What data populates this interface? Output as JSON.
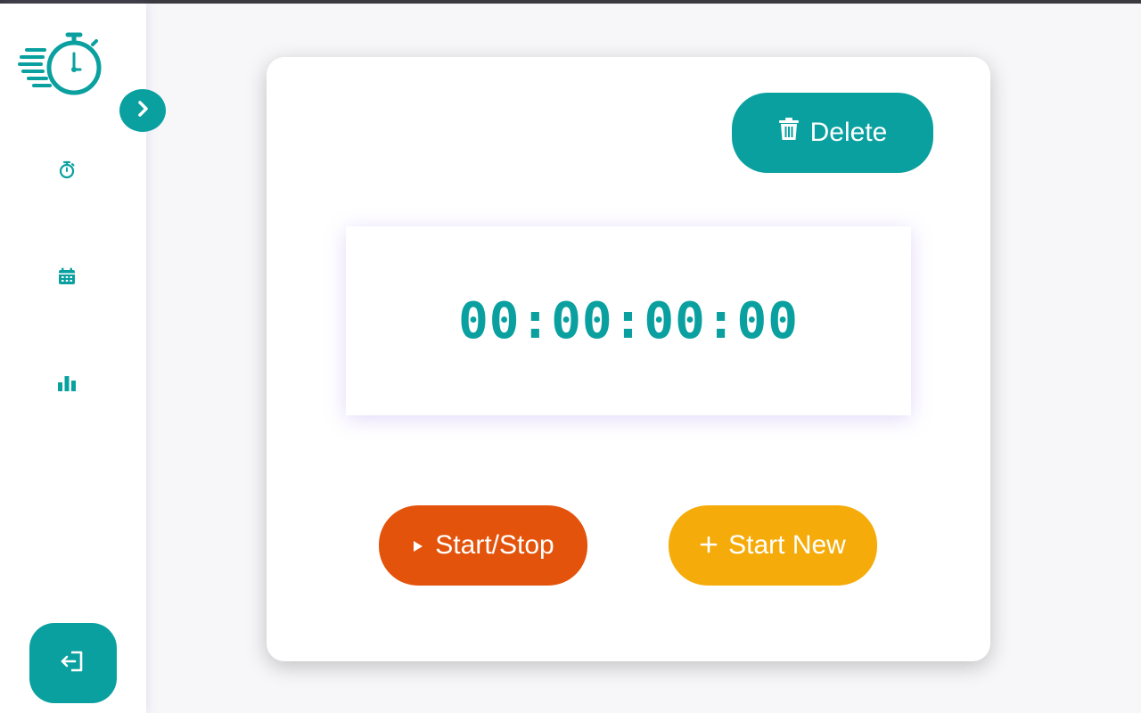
{
  "sidebar": {
    "logo_icon": "stopwatch-logo-icon",
    "expand_icon": "chevron-right-icon",
    "items": [
      {
        "name": "timer",
        "icon": "stopwatch-icon"
      },
      {
        "name": "calendar",
        "icon": "calendar-icon"
      },
      {
        "name": "stats",
        "icon": "bar-chart-icon"
      }
    ],
    "logout_icon": "logout-icon"
  },
  "timer": {
    "display": "00:00:00:00"
  },
  "buttons": {
    "delete_label": "Delete",
    "delete_icon": "trash-icon",
    "start_stop_label": "Start/Stop",
    "start_stop_icon": "play-icon",
    "start_new_label": "Start New",
    "start_new_icon": "plus-icon"
  },
  "colors": {
    "accent": "#0aa0a0",
    "start_stop": "#e3530b",
    "start_new": "#f5ac0a"
  }
}
